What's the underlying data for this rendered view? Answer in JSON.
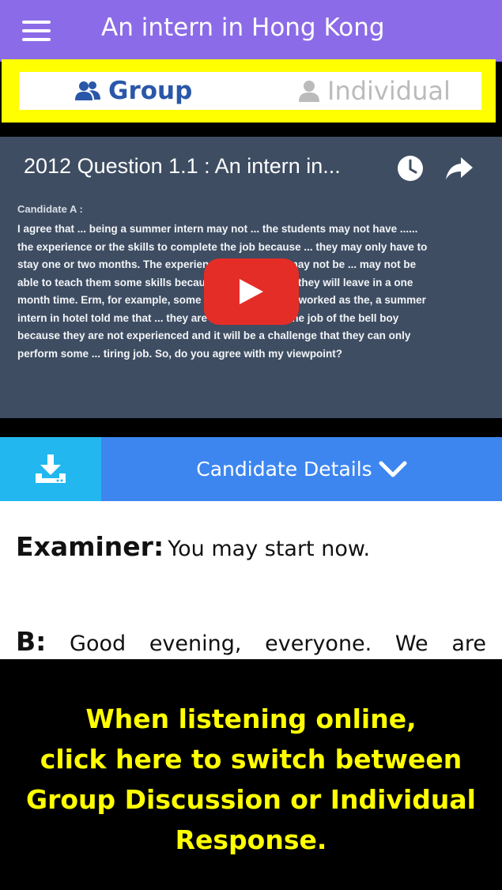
{
  "appbar": {
    "title": "An intern in Hong Kong",
    "menu_icon": "hamburger-menu-icon"
  },
  "tabs": [
    {
      "label": "Group",
      "icon": "group-users-icon",
      "active": true
    },
    {
      "label": "Individual",
      "icon": "single-user-icon",
      "active": false
    }
  ],
  "video": {
    "title": "2012 Question 1.1 : An intern in...",
    "candidate_heading": "Candidate A :",
    "candidate_text": "I agree that ... being a summer intern may not ... the students may not have ...... the experience or the skills to complete the job because ... they may only have to stay one or two months. The experienced colleagues may not be ... may not be able to teach them some skills because they know that they will leave in a one month time. Erm, for example, some of my friends who worked as the, a summer intern in hotel told me that ... they are only able to do the job of the bell boy because they are not experienced and it will be a challenge that they can only perform some ... tiring job. So, do you agree with my viewpoint?",
    "icons": [
      "clock-icon",
      "share-icon",
      "play-icon"
    ]
  },
  "actions": {
    "download_icon": "download-icon",
    "details_label": "Candidate Details",
    "details_icon": "chevron-down-icon"
  },
  "transcript": [
    {
      "speaker": "Examiner:",
      "text": "You may start now."
    },
    {
      "speaker": "B:",
      "words": [
        "Good",
        "evening,",
        "everyone.",
        "We",
        "are"
      ]
    }
  ],
  "overlay": {
    "lines": [
      "When listening online,",
      "click here to switch between",
      "Group Discussion or Individual",
      "Response."
    ]
  },
  "colors": {
    "appbar": "#8B6BE7",
    "highlight": "#FFFF00",
    "download": "#22B7EE",
    "details": "#3D86F0",
    "overlay_text": "#FFFF00"
  }
}
